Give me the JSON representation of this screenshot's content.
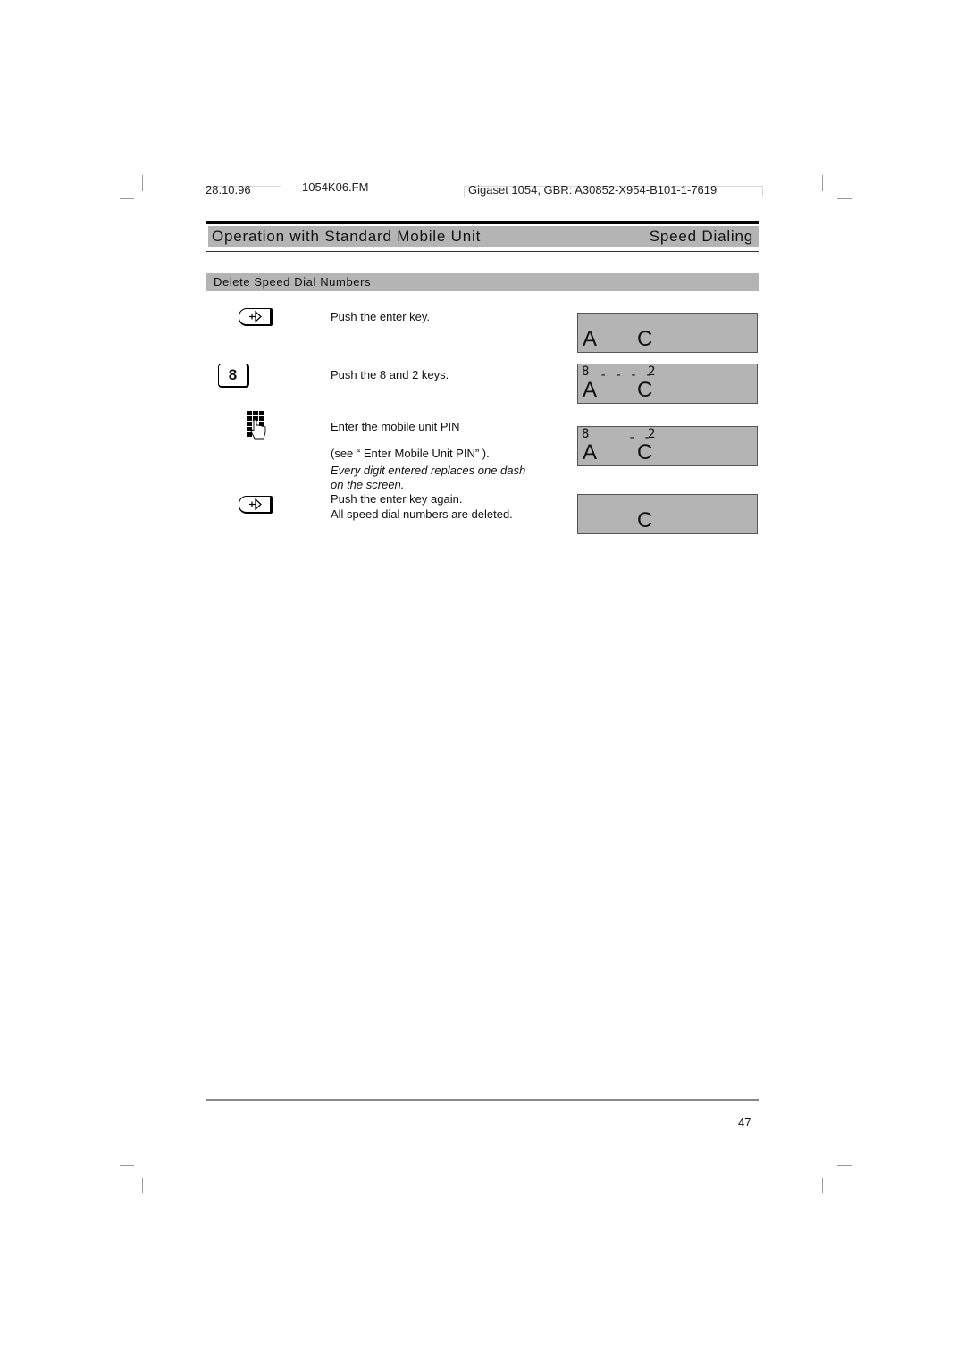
{
  "header": {
    "date": "28.10.96",
    "file": "1054K06.FM",
    "doc_ref": "Gigaset 1054, GBR: A30852-X954-B101-1-7619"
  },
  "title_bar": {
    "left": "Operation with Standard Mobile Unit",
    "right": "Speed Dialing"
  },
  "section": {
    "title": "Delete Speed Dial Numbers"
  },
  "steps": [
    {
      "icon": "enter-key-icon",
      "text": "Push the enter key."
    },
    {
      "icon": "key-8-icon",
      "key_label": "8",
      "text": "Push the 8 and 2 keys."
    },
    {
      "icon": "keypad-hand-icon",
      "text": "Enter the mobile unit PIN",
      "text2": "(see “ Enter Mobile Unit PIN” ).",
      "note": "Every digit entered replaces one dash",
      "note2": "on the screen."
    },
    {
      "icon": "enter-key-icon",
      "text": "Push the enter key again.",
      "text2": "All speed dial numbers are deleted."
    }
  ],
  "displays": [
    {
      "small_left": "",
      "dashes": "",
      "small_right": "",
      "big_left": "A",
      "big_right": "C"
    },
    {
      "small_left": "8",
      "dashes": "- - - -",
      "small_right": "2",
      "big_left": "A",
      "big_right": "C"
    },
    {
      "small_left": "8",
      "dashes": "- -",
      "small_right": "2",
      "big_left": "A",
      "big_right": "C"
    },
    {
      "small_left": "",
      "dashes": "",
      "small_right": "",
      "big_left": "",
      "big_right": "C"
    }
  ],
  "footer": {
    "page_number": "47"
  }
}
